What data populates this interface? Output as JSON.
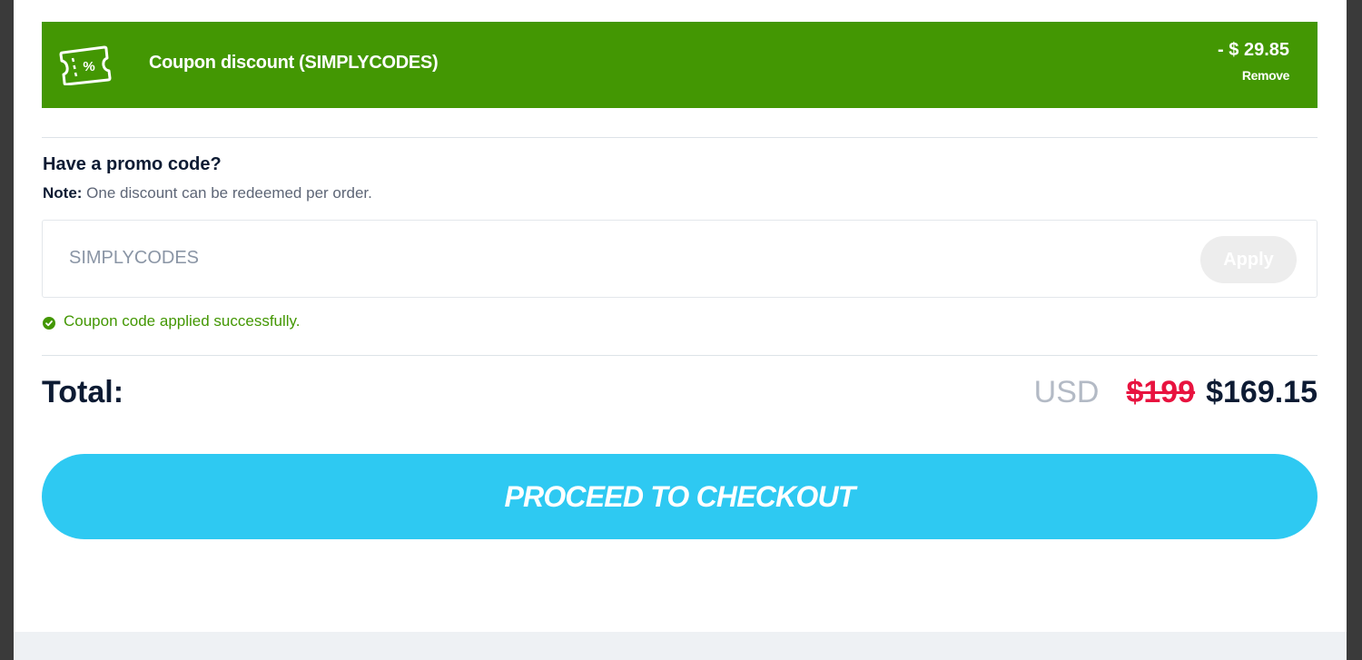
{
  "coupon_banner": {
    "label": "Coupon discount (SIMPLYCODES)",
    "amount": "- $ 29.85",
    "remove_label": "Remove",
    "icon": "coupon-ticket-icon",
    "color": "#439703"
  },
  "promo": {
    "heading": "Have a promo code?",
    "note_label": "Note:",
    "note_text": " One discount can be redeemed per order.",
    "input_value": "SIMPLYCODES",
    "apply_label": "Apply",
    "success_text": "Coupon code applied successfully.",
    "success_icon": "check-circle-icon"
  },
  "total": {
    "label": "Total:",
    "currency": "USD",
    "original_price": "$199",
    "final_price": "$169.15",
    "strike_color": "#e8133f"
  },
  "checkout": {
    "label": "PROCEED TO CHECKOUT",
    "color": "#2ec9f2"
  }
}
